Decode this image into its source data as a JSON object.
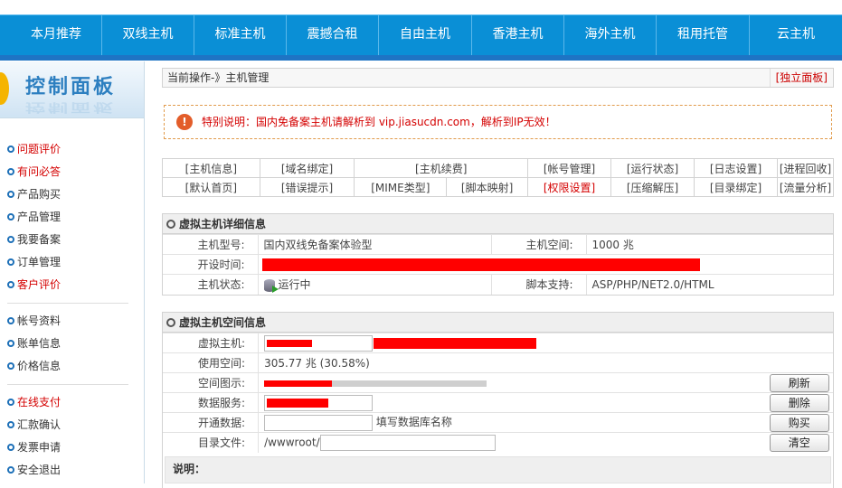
{
  "nav": {
    "items": [
      {
        "label": "本月推荐"
      },
      {
        "label": "双线主机"
      },
      {
        "label": "标准主机"
      },
      {
        "label": "震撼合租"
      },
      {
        "label": "自由主机"
      },
      {
        "label": "香港主机"
      },
      {
        "label": "海外主机"
      },
      {
        "label": "租用托管"
      },
      {
        "label": "云主机"
      }
    ]
  },
  "sidebar": {
    "title": "控制面板",
    "groups": [
      [
        {
          "label": "问题评价",
          "red": true
        },
        {
          "label": "有问必答",
          "red": true
        },
        {
          "label": "产品购买",
          "red": false
        },
        {
          "label": "产品管理",
          "red": false
        },
        {
          "label": "我要备案",
          "red": false
        },
        {
          "label": "订单管理",
          "red": false
        },
        {
          "label": "客户评价",
          "red": true
        }
      ],
      [
        {
          "label": "帐号资料",
          "red": false
        },
        {
          "label": "账单信息",
          "red": false
        },
        {
          "label": "价格信息",
          "red": false
        }
      ],
      [
        {
          "label": "在线支付",
          "red": true
        },
        {
          "label": "汇款确认",
          "red": false
        },
        {
          "label": "发票申请",
          "red": false
        },
        {
          "label": "安全退出",
          "red": false
        }
      ]
    ]
  },
  "crumb": {
    "text": "当前操作-》主机管理",
    "standalone": "[独立面板]"
  },
  "notice": {
    "text": "特别说明：国内免备案主机请解析到 vip.jiasucdn.com，解析到IP无效！"
  },
  "funcs": {
    "row1": [
      "[主机信息]",
      "[域名绑定]",
      "[主机续费]",
      "[帐号管理]",
      "[运行状态]",
      "[日志设置]",
      "[进程回收]"
    ],
    "row2": [
      "[默认首页]",
      "[错误提示]",
      "[MIME类型]",
      "[脚本映射]",
      "[权限设置]",
      "[压缩解压]",
      "[目录绑定]",
      "[流量分析]"
    ]
  },
  "detail": {
    "title": "虚拟主机详细信息",
    "model_label": "主机型号:",
    "model_value": "国内双线免备案体验型",
    "space_label": "主机空间:",
    "space_value": "1000 兆",
    "open_label": "开设时间:",
    "status_label": "主机状态:",
    "status_value": "运行中",
    "script_label": "脚本支持:",
    "script_value": "ASP/PHP/NET2.0/HTML"
  },
  "space": {
    "title": "虚拟主机空间信息",
    "vhost_label": "虚拟主机:",
    "used_label": "使用空间:",
    "used_value": "305.77 兆  (30.58%)",
    "used_fraction": 0.3058,
    "chart_label": "空间图示:",
    "db_label": "数据服务:",
    "opendb_label": "开通数据:",
    "opendb_hint": "填写数据库名称",
    "dir_label": "目录文件:",
    "dir_prefix": "/wwwroot/",
    "btn_refresh": "刷新",
    "btn_delete": "删除",
    "btn_buy": "购买",
    "btn_clear": "清空",
    "note_label": "说明："
  }
}
